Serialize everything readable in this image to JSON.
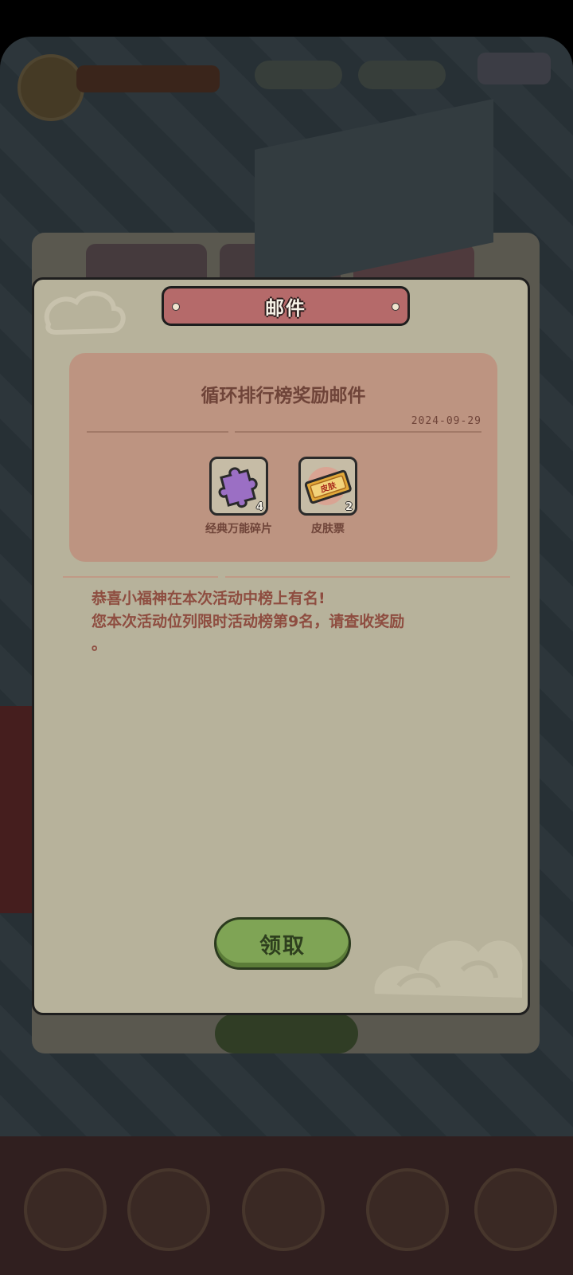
{
  "modal": {
    "title": "邮件",
    "mail": {
      "subject": "循环排行榜奖励邮件",
      "date": "2024-09-29",
      "rewards": [
        {
          "name": "经典万能碎片",
          "count": "4",
          "icon": "puzzle-piece-icon",
          "color": "#9b6fc4"
        },
        {
          "name": "皮肤票",
          "count": "2",
          "icon": "skin-ticket-icon",
          "color": "#e2a83a"
        }
      ],
      "body_lines": [
        "恭喜小福神在本次活动中榜上有名!",
        "您本次活动位列限时活动榜第9名，请查收奖励",
        "。"
      ]
    },
    "claim_button": "领取"
  },
  "colors": {
    "modal_bg": "#b7b29b",
    "card_bg": "#bd9481",
    "title_plate": "#b56a6a",
    "button_green": "#7fa455",
    "text_brown": "#8e4d40"
  }
}
